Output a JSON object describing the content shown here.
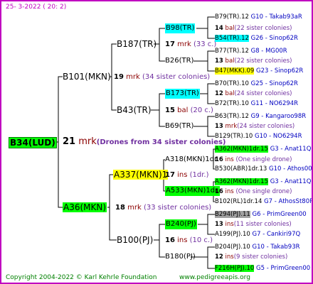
{
  "header": {
    "date": "25-  3-2022 ( 20:  2)"
  },
  "root": {
    "id": "B34(LUD)",
    "num": "21",
    "mrk": "mrk",
    "note": "(Drones from 34 sister colonies)"
  },
  "g1": [
    {
      "id": "B101(MKN)",
      "num": "19",
      "mrk": "mrk",
      "note": "(34 sister colonies)"
    },
    {
      "id": "A36(MKN)",
      "num": "18",
      "mrk": "mrk",
      "note": "(33 sister colonies)"
    }
  ],
  "g2": [
    {
      "id": "B187(TR)",
      "num": "17",
      "mrk": "mrk",
      "note": "(33 c.)"
    },
    {
      "id": "B43(TR)",
      "num": "15",
      "mrk": "bal",
      "note": "(20 c.)"
    },
    {
      "id": "A337(MKN)1",
      "num": "17",
      "mrk": "ins",
      "note": "(1dr.)"
    },
    {
      "id": "B100(PJ)",
      "num": "16",
      "mrk": "ins",
      "note": "(10 c.)"
    }
  ],
  "g3": [
    {
      "id": "B98(TR)",
      "num": "14",
      "mrk": "bal",
      "note": "(22 sister colonies)"
    },
    {
      "id": "B26(TR)",
      "num": "13",
      "mrk": "bal",
      "note": "(22 sister colonies)"
    },
    {
      "id": "B173(TR)",
      "num": "12",
      "mrk": "bal",
      "note": "(24 sister colonies)"
    },
    {
      "id": "B69(TR)",
      "num": "13",
      "mrk": "mrk",
      "note": "(24 sister colonies)"
    },
    {
      "id": "A318(MKN)1dr.",
      "num": "16",
      "mrk": "ins",
      "note": "(One single drone)"
    },
    {
      "id": "A533(MKN)1dr.",
      "num": "16",
      "mrk": "ins",
      "note": "(One single drone)"
    },
    {
      "id": "B240(PJ)",
      "num": "13",
      "mrk": "ins",
      "note": "(11 sister colonies)"
    },
    {
      "id": "B180(PJ)",
      "num": "12",
      "mrk": "ins",
      "note": "(9 sister colonies)"
    }
  ],
  "g4": [
    {
      "id": "B79(TR).12",
      "rel": "G10 - Takab93aR"
    },
    {
      "id": "B54(TR).12",
      "rel": "G26 - Sinop62R"
    },
    {
      "id": "B77(TR).12",
      "rel": "G8 - MG00R"
    },
    {
      "id": "B47(MKK).09",
      "rel": "G23 - Sinop62R"
    },
    {
      "id": "B70(TR).10",
      "rel": "G25 - Sinop62R"
    },
    {
      "id": "B72(TR).10",
      "rel": "G11 - NO6294R"
    },
    {
      "id": "B63(TR).12",
      "rel": "G9 - Kangaroo98R"
    },
    {
      "id": "B129(TR).10",
      "rel": "G10 - NO6294R"
    },
    {
      "id": "A362(MKN)1dr.15",
      "rel": "G3 - Anat11Q"
    },
    {
      "id": "B530(ABR)1dr.13",
      "rel": "G10 - Athos00R"
    },
    {
      "id": "A362(MKN)1dr.15",
      "rel": "G3 - Anat11Q"
    },
    {
      "id": "B102(RL)1dr.14",
      "rel": "G7 - AthosSt80R"
    },
    {
      "id": "B294(PJ).11",
      "rel": "G6 - PrimGreen00"
    },
    {
      "id": "A199(PJ).10",
      "rel": "G7 - Cankiri97Q"
    },
    {
      "id": "B204(PJ).10",
      "rel": "G10 - Takab93R"
    },
    {
      "id": "F216H(PJ).10",
      "rel": "G5 - PrimGreen00"
    }
  ],
  "footer": {
    "copyright": "Copyright 2004-2022 © Karl Kehrle Foundation",
    "site": "www.pedigreeapis.org"
  },
  "colors": {
    "border": "#c000c0",
    "green": "#00ff00",
    "cyan": "#00ffff",
    "yellow": "#ffff00",
    "gray": "#a0a0a0",
    "mark": "#8b0000",
    "sister": "#7030a0",
    "relation": "#0000c0"
  }
}
